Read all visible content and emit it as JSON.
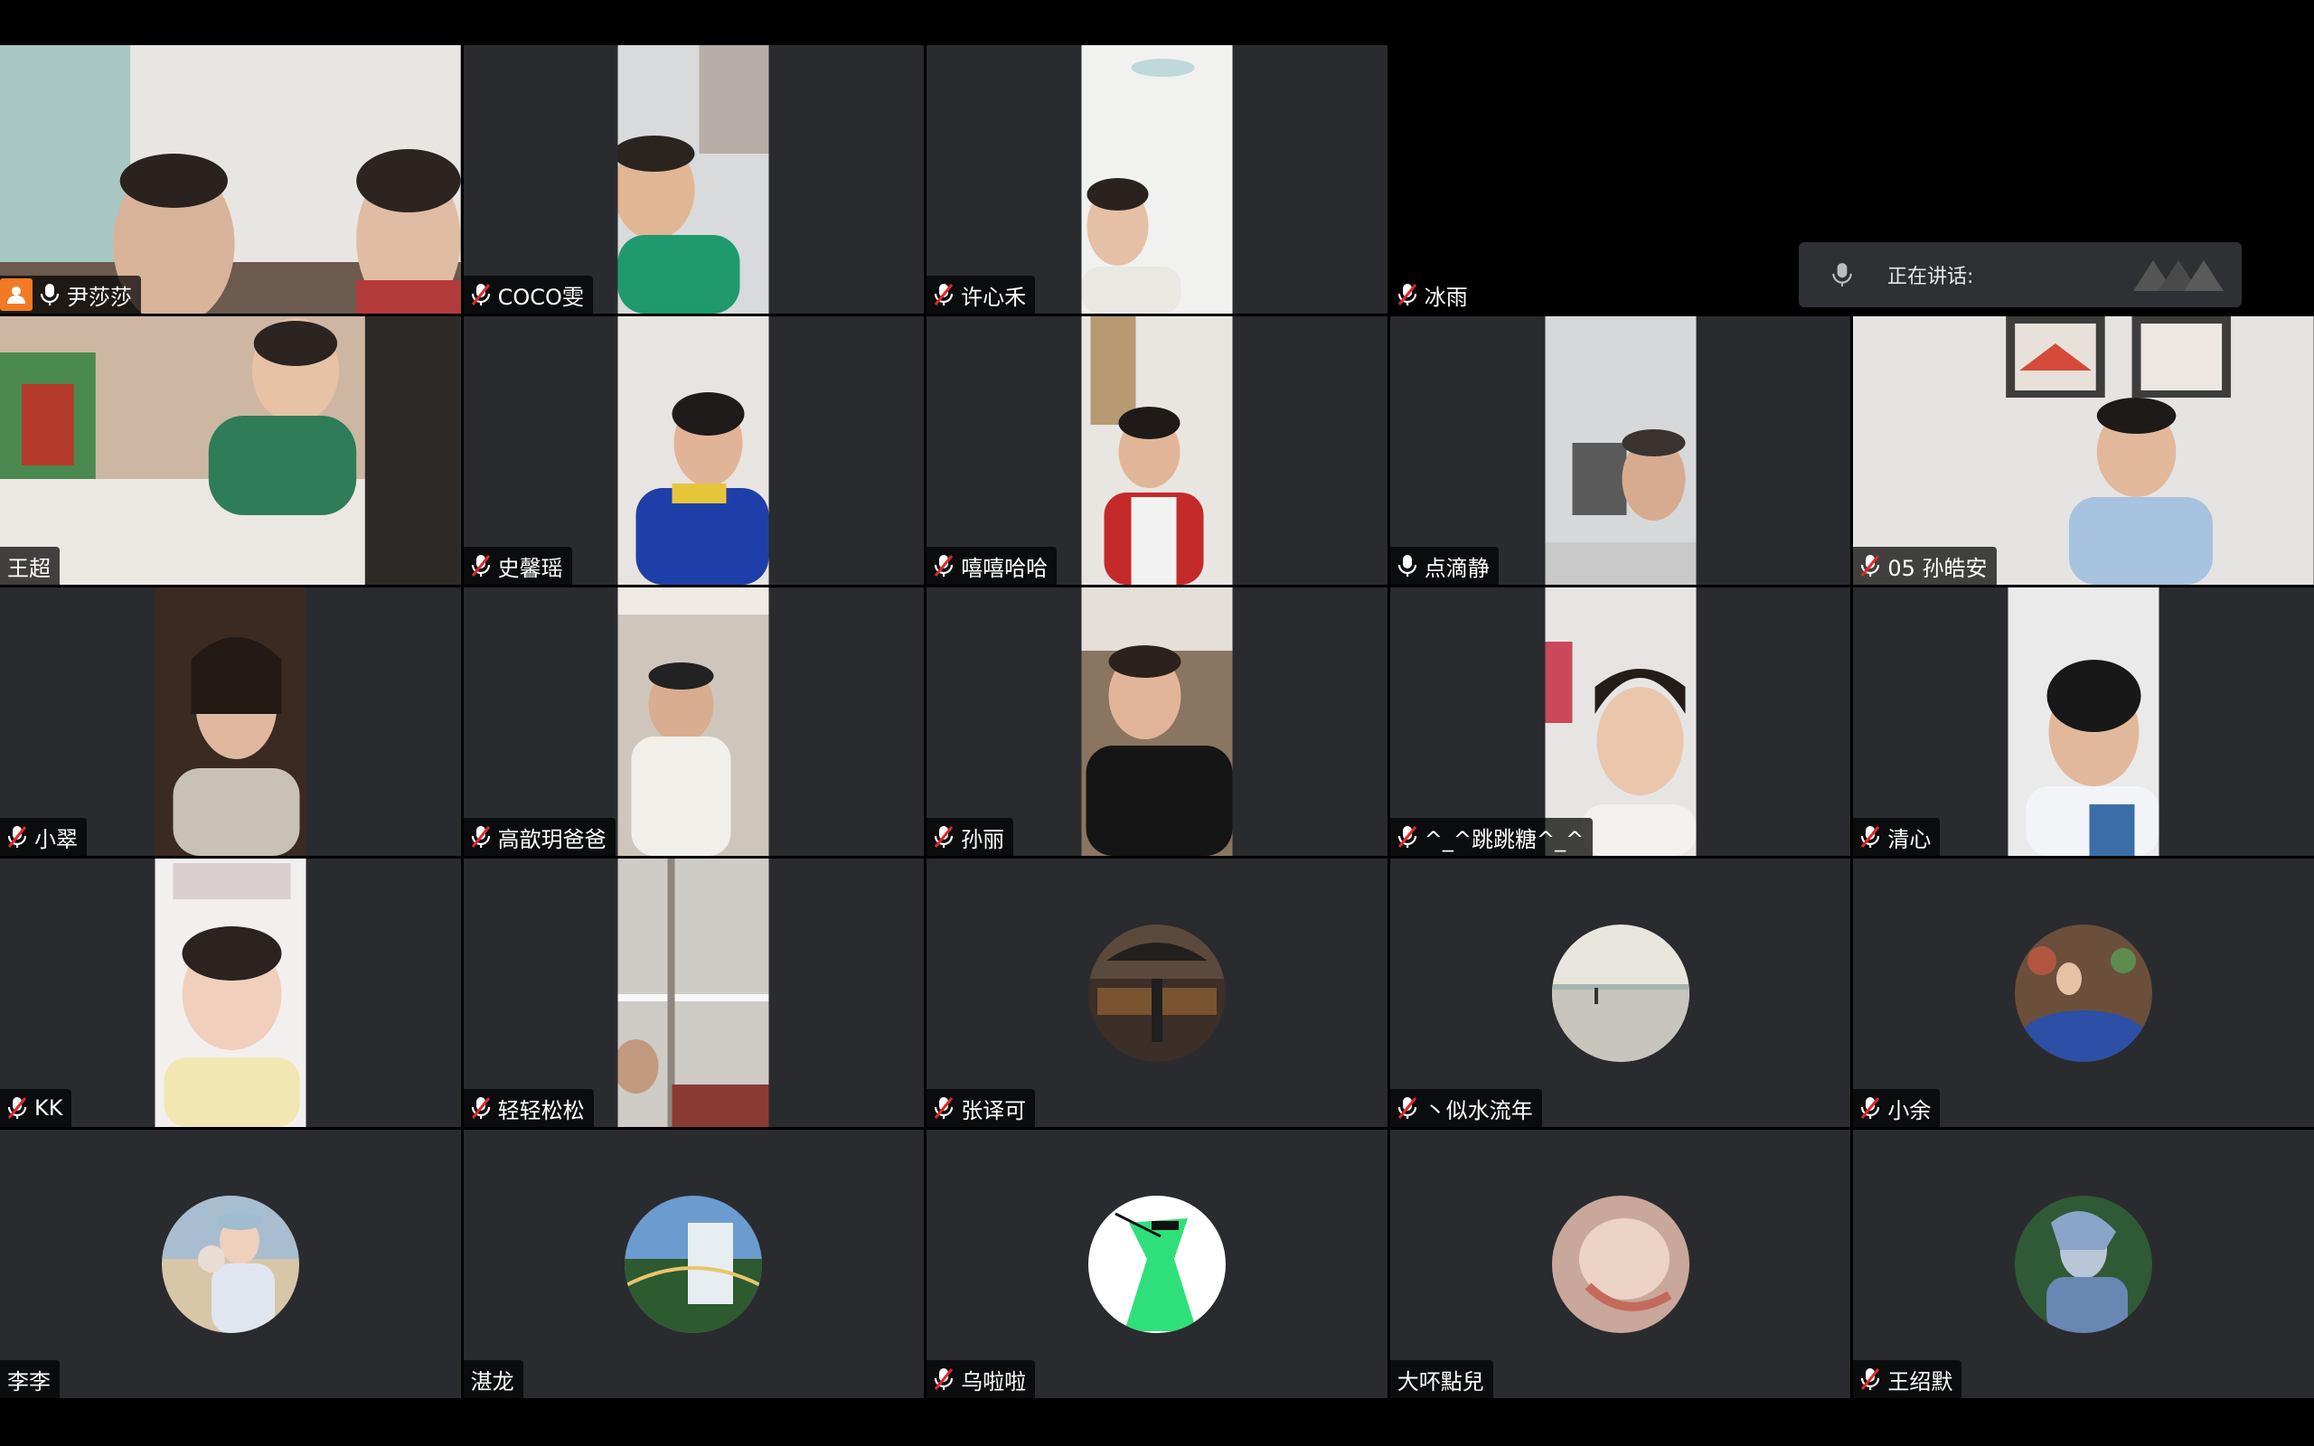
{
  "speaking_panel": {
    "label": "正在讲话:"
  },
  "participants": [
    {
      "name": "尹莎莎",
      "mic": "on",
      "host": true
    },
    {
      "name": "COCO雯",
      "mic": "muted"
    },
    {
      "name": "许心禾",
      "mic": "muted"
    },
    {
      "name": "冰雨",
      "mic": "muted"
    },
    {
      "name": "",
      "mic": "none"
    },
    {
      "name": "王超",
      "mic": "none"
    },
    {
      "name": "史馨瑶",
      "mic": "muted"
    },
    {
      "name": "嘻嘻哈哈",
      "mic": "muted"
    },
    {
      "name": "点滴静",
      "mic": "on"
    },
    {
      "name": "05 孙皓安",
      "mic": "muted"
    },
    {
      "name": "小翠",
      "mic": "muted"
    },
    {
      "name": "高歆玥爸爸",
      "mic": "muted"
    },
    {
      "name": "孙丽",
      "mic": "muted"
    },
    {
      "name": "^_^跳跳糖^_^",
      "mic": "muted"
    },
    {
      "name": "清心",
      "mic": "muted"
    },
    {
      "name": "KK",
      "mic": "muted"
    },
    {
      "name": "轻轻松松",
      "mic": "muted"
    },
    {
      "name": "张译可",
      "mic": "muted"
    },
    {
      "name": "丶似水流年",
      "mic": "muted"
    },
    {
      "name": "小余",
      "mic": "muted"
    },
    {
      "name": "李李",
      "mic": "none"
    },
    {
      "name": "湛龙",
      "mic": "none"
    },
    {
      "name": "乌啦啦",
      "mic": "muted"
    },
    {
      "name": "大吥點兒",
      "mic": "none"
    },
    {
      "name": "王绍默",
      "mic": "muted"
    }
  ]
}
